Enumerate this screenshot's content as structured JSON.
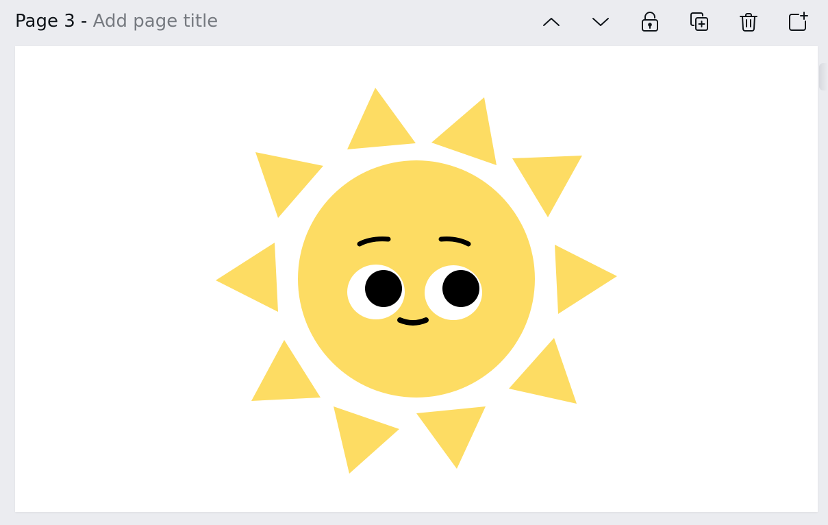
{
  "page": {
    "label": "Page 3 -",
    "title_placeholder": "Add page title"
  },
  "toolbar": {
    "buttons": [
      {
        "name": "move-page-up",
        "icon": "chevron-up-icon"
      },
      {
        "name": "move-page-down",
        "icon": "chevron-down-icon"
      },
      {
        "name": "lock-page",
        "icon": "unlock-icon"
      },
      {
        "name": "duplicate-page",
        "icon": "duplicate-icon"
      },
      {
        "name": "delete-page",
        "icon": "trash-icon"
      },
      {
        "name": "add-page",
        "icon": "add-page-icon"
      }
    ]
  },
  "canvas": {
    "background": "#ffffff",
    "element": "sun-illustration",
    "colors": {
      "sun": "#fddc63",
      "face": "#000000",
      "eye_white": "#ffffff"
    }
  }
}
